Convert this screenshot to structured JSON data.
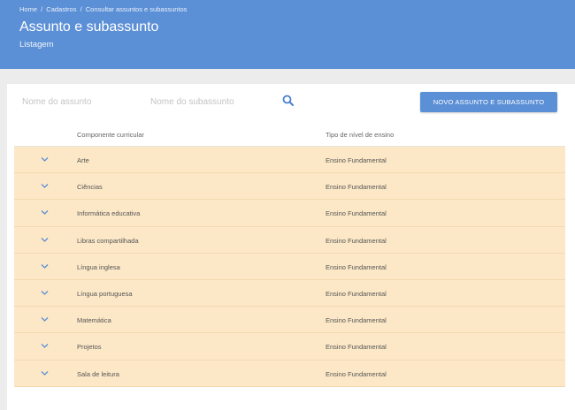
{
  "breadcrumb": {
    "items": [
      "Home",
      "Cadastros",
      "Consultar assuntos e subassuntos"
    ],
    "separator": "/"
  },
  "header": {
    "title": "Assunto e subassunto",
    "subtitle": "Listagem"
  },
  "filters": {
    "assunto_placeholder": "Nome do assunto",
    "subassunto_placeholder": "Nome do subassunto",
    "search_icon": "search-icon"
  },
  "actions": {
    "new_label": "NOVO ASSUNTO E SUBASSUNTO"
  },
  "table": {
    "columns": [
      "Componente curricular",
      "Tipo de nível de ensino"
    ],
    "rows": [
      {
        "componente": "Arte",
        "tipo": "Ensino Fundamental"
      },
      {
        "componente": "Ciências",
        "tipo": "Ensino Fundamental"
      },
      {
        "componente": "Informática educativa",
        "tipo": "Ensino Fundamental"
      },
      {
        "componente": "Libras compartilhada",
        "tipo": "Ensino Fundamental"
      },
      {
        "componente": "Língua inglesa",
        "tipo": "Ensino Fundamental"
      },
      {
        "componente": "Língua portuguesa",
        "tipo": "Ensino Fundamental"
      },
      {
        "componente": "Matemática",
        "tipo": "Ensino Fundamental"
      },
      {
        "componente": "Projetos",
        "tipo": "Ensino Fundamental"
      },
      {
        "componente": "Sala de leitura",
        "tipo": "Ensino Fundamental"
      }
    ],
    "row_icon": "chevron-down-icon"
  },
  "colors": {
    "header_bg": "#5b8fd6",
    "row_bg": "#fce8c7",
    "accent": "#5b8fd6"
  }
}
